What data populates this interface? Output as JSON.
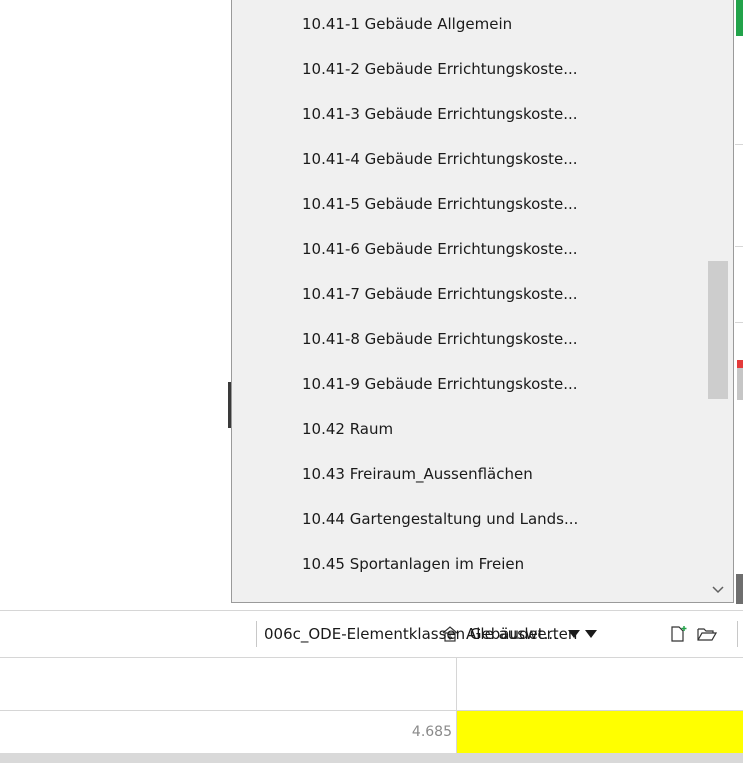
{
  "dropdown": {
    "items": [
      {
        "label": "10.41-1 Gebäude Allgemein"
      },
      {
        "label": "10.41-2 Gebäude Errichtungskoste..."
      },
      {
        "label": "10.41-3 Gebäude Errichtungskoste..."
      },
      {
        "label": "10.41-4 Gebäude Errichtungskoste..."
      },
      {
        "label": "10.41-5 Gebäude Errichtungskoste..."
      },
      {
        "label": "10.41-6 Gebäude Errichtungskoste..."
      },
      {
        "label": "10.41-7 Gebäude Errichtungskoste..."
      },
      {
        "label": "10.41-8 Gebäude Errichtungskoste..."
      },
      {
        "label": "10.41-9 Gebäude Errichtungskoste..."
      },
      {
        "label": "10.42 Raum"
      },
      {
        "label": "10.43 Freiraum_Aussenflächen"
      },
      {
        "label": "10.44 Gartengestaltung und Lands..."
      },
      {
        "label": "10.45 Sportanlagen im Freien"
      }
    ]
  },
  "toolbar": {
    "evaluate_label": "Alle auswerten",
    "evaluate_icon": "evaluate-icon",
    "profile_label": "006c_ODE-Elementklassen Gebäudet...",
    "new_icon": "new-document-icon",
    "open_icon": "open-folder-icon"
  },
  "grid": {
    "value": "4.685",
    "highlight_color": "#ffff00"
  },
  "colors": {
    "accent_green": "#22a34a",
    "accent_red": "#e33a3a"
  }
}
